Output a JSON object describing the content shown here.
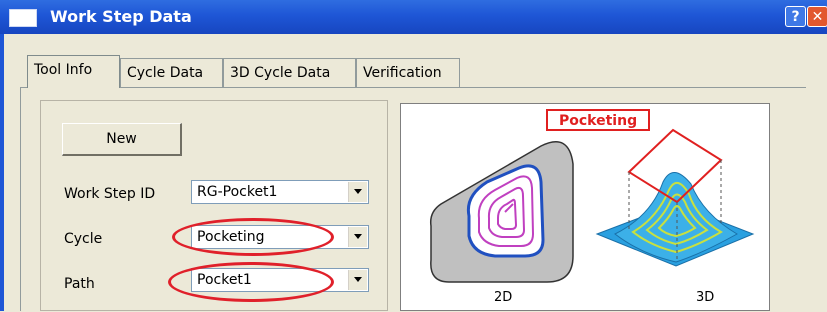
{
  "window": {
    "title": "Work Step Data",
    "help_label": "?",
    "close_label": "✕"
  },
  "tabs": [
    {
      "label": "Tool Info",
      "active": true
    },
    {
      "label": "Cycle Data",
      "active": false
    },
    {
      "label": "3D Cycle Data",
      "active": false
    },
    {
      "label": "Verification",
      "active": false
    }
  ],
  "tool_info": {
    "new_button": "New",
    "fields": [
      {
        "label": "Work Step ID",
        "value": "RG-Pocket1"
      },
      {
        "label": "Cycle",
        "value": "Pocketing"
      },
      {
        "label": "Path",
        "value": "Pocket1"
      }
    ]
  },
  "preview": {
    "title": "Pocketing",
    "left_view_label": "2D",
    "right_view_label": "3D"
  },
  "colors": {
    "title_bar": "#1e56d6",
    "highlight": "#e0202a",
    "pocket_path": "#c040c0",
    "surface": "#2aa0e0",
    "toolpath_3d": "#c8e040"
  }
}
